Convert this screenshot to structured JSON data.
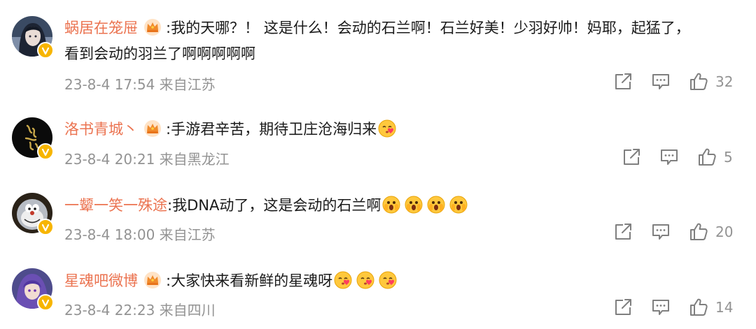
{
  "comments": [
    {
      "username": "蜗居在笼屉",
      "text_line1": ":我的天哪？！ 这是什么！会动的石兰啊！石兰好美！少羽好帅！妈耶，起猛了，",
      "text_line2": "看到会动的羽兰了啊啊啊啊啊",
      "meta": "23-8-4 17:54 来自江苏",
      "likes": "32",
      "avatar_icon": "female-character-avatar",
      "emojis": []
    },
    {
      "username": "洛书青城丶",
      "text_line1": ":手游君辛苦，期待卫庄沧海归来",
      "meta": "23-8-4 20:21 来自黑龙江",
      "likes": "5",
      "avatar_icon": "dark-calligraphy-avatar",
      "emojis": [
        "heart-kiss-emoji"
      ]
    },
    {
      "username": "一颦一笑一殊途",
      "text_line1": ":我DNA动了，这是会动的石兰啊",
      "meta": "23-8-4 18:00 来自江苏",
      "likes": "20",
      "avatar_icon": "doraemon-avatar",
      "emojis": [
        "shocked-emoji",
        "shocked-emoji",
        "shocked-emoji",
        "shocked-emoji"
      ]
    },
    {
      "username": "星魂吧微博",
      "text_line1": ":大家快来看新鲜的星魂呀",
      "meta": "23-8-4 22:23 来自四川",
      "likes": "14",
      "avatar_icon": "purple-hair-character-avatar",
      "emojis": [
        "heart-kiss-emoji",
        "heart-kiss-emoji",
        "heart-kiss-emoji"
      ]
    }
  ],
  "colors": {
    "username": "#eb7350",
    "text": "#1a1a1a",
    "meta": "#939393",
    "verified_badge": "#f7b500"
  }
}
